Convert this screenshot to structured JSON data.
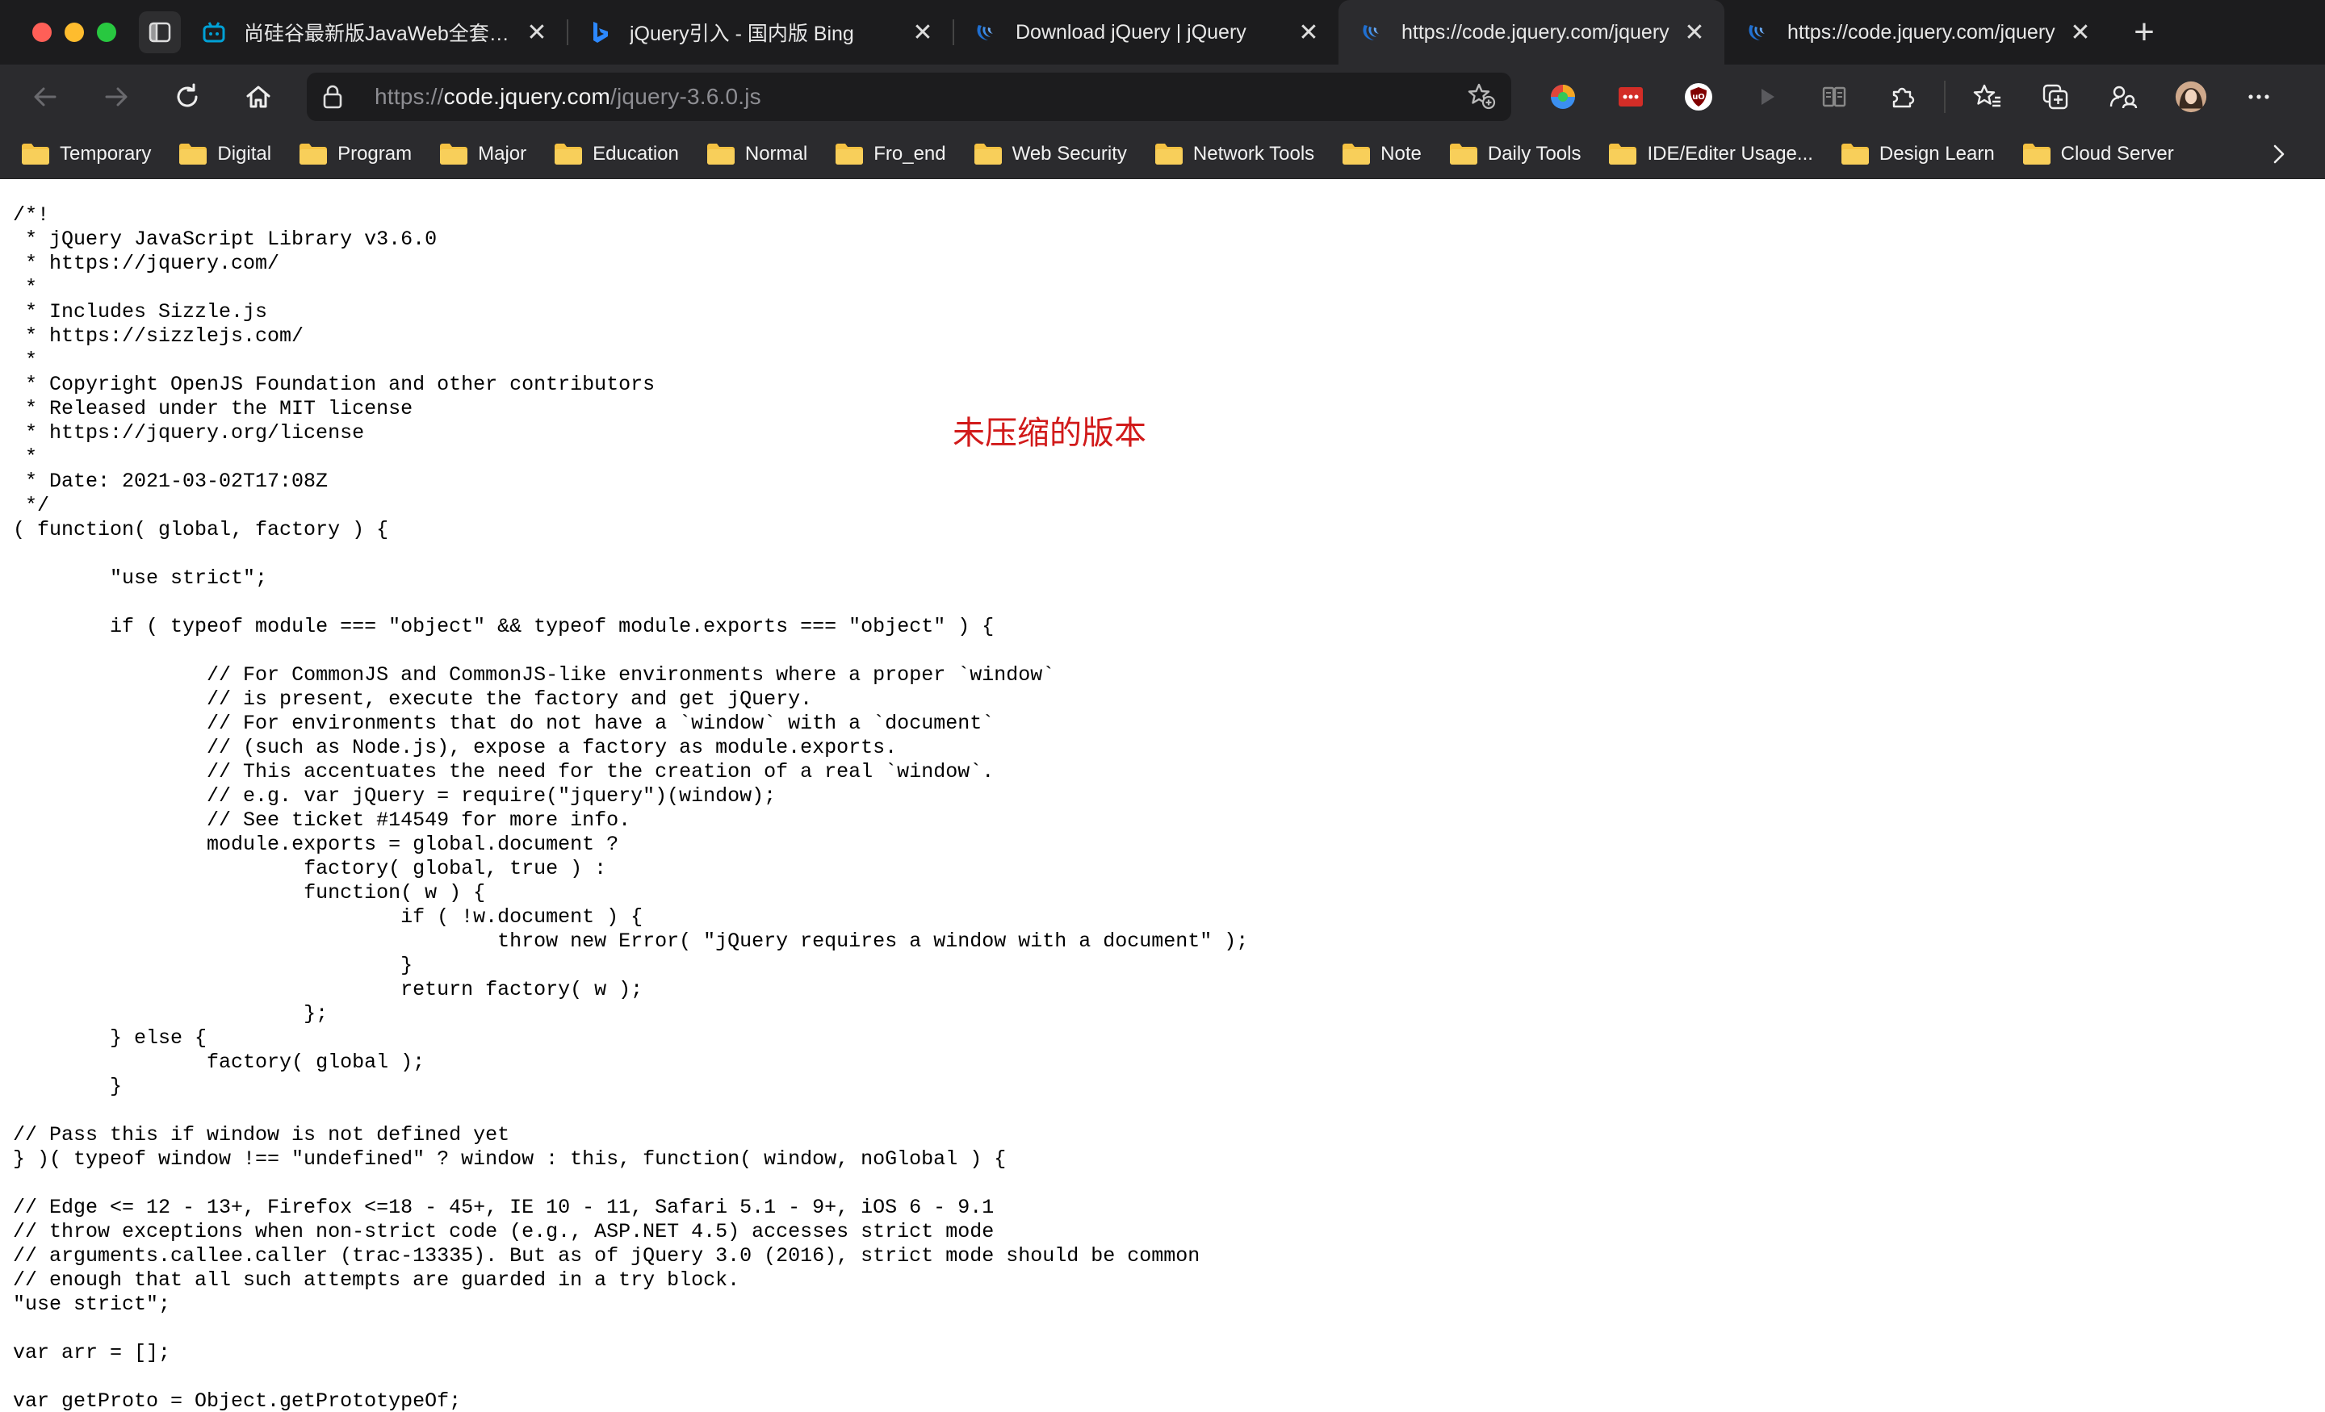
{
  "tabs": [
    {
      "title": "尚硅谷最新版JavaWeb全套教程",
      "close": "✕",
      "favicon": "bilibili-icon"
    },
    {
      "title": "jQuery引入 - 国内版 Bing",
      "close": "✕",
      "favicon": "bing-icon"
    },
    {
      "title": "Download jQuery | jQuery",
      "close": "✕",
      "favicon": "jquery-icon"
    },
    {
      "title": "https://code.jquery.com/jquery",
      "close": "✕",
      "favicon": "jquery-icon",
      "active": true
    },
    {
      "title": "https://code.jquery.com/jquery",
      "close": "✕",
      "favicon": "jquery-icon"
    }
  ],
  "new_tab": "+",
  "address": {
    "scheme": "https://",
    "host": "code.jquery.com",
    "path": "/jquery-3.6.0.js"
  },
  "bookmarks": [
    "Temporary",
    "Digital",
    "Program",
    "Major",
    "Education",
    "Normal",
    "Fro_end",
    "Web Security",
    "Network Tools",
    "Note",
    "Daily Tools",
    "IDE/Editer Usage...",
    "Design Learn",
    "Cloud Server"
  ],
  "annotation": "未压缩的版本",
  "source_code": "/*!\n * jQuery JavaScript Library v3.6.0\n * https://jquery.com/\n *\n * Includes Sizzle.js\n * https://sizzlejs.com/\n *\n * Copyright OpenJS Foundation and other contributors\n * Released under the MIT license\n * https://jquery.org/license\n *\n * Date: 2021-03-02T17:08Z\n */\n( function( global, factory ) {\n\n\t\"use strict\";\n\n\tif ( typeof module === \"object\" && typeof module.exports === \"object\" ) {\n\n\t\t// For CommonJS and CommonJS-like environments where a proper `window`\n\t\t// is present, execute the factory and get jQuery.\n\t\t// For environments that do not have a `window` with a `document`\n\t\t// (such as Node.js), expose a factory as module.exports.\n\t\t// This accentuates the need for the creation of a real `window`.\n\t\t// e.g. var jQuery = require(\"jquery\")(window);\n\t\t// See ticket #14549 for more info.\n\t\tmodule.exports = global.document ?\n\t\t\tfactory( global, true ) :\n\t\t\tfunction( w ) {\n\t\t\t\tif ( !w.document ) {\n\t\t\t\t\tthrow new Error( \"jQuery requires a window with a document\" );\n\t\t\t\t}\n\t\t\t\treturn factory( w );\n\t\t\t};\n\t} else {\n\t\tfactory( global );\n\t}\n\n// Pass this if window is not defined yet\n} )( typeof window !== \"undefined\" ? window : this, function( window, noGlobal ) {\n\n// Edge <= 12 - 13+, Firefox <=18 - 45+, IE 10 - 11, Safari 5.1 - 9+, iOS 6 - 9.1\n// throw exceptions when non-strict code (e.g., ASP.NET 4.5) accesses strict mode\n// arguments.callee.caller (trac-13335). But as of jQuery 3.0 (2016), strict mode should be common\n// enough that all such attempts are guarded in a try block.\n\"use strict\";\n\nvar arr = [];\n\nvar getProto = Object.getPrototypeOf;",
  "colors": {
    "tabstrip_bg": "#1c1c1e",
    "toolbar_bg": "#2b2b2e",
    "annotation": "#d11a1a",
    "folder": "#f5c242"
  },
  "toolbar_icons": [
    "back-icon",
    "forward-icon",
    "refresh-icon",
    "home-icon",
    "lock-icon",
    "add-favorite-icon"
  ],
  "extension_icons": [
    "color-extension-icon",
    "lastpass-icon",
    "ublock-icon",
    "play-icon",
    "reader-icon",
    "extensions-icon",
    "favorites-icon",
    "collections-icon",
    "profile-sync-icon",
    "avatar",
    "more-icon"
  ]
}
